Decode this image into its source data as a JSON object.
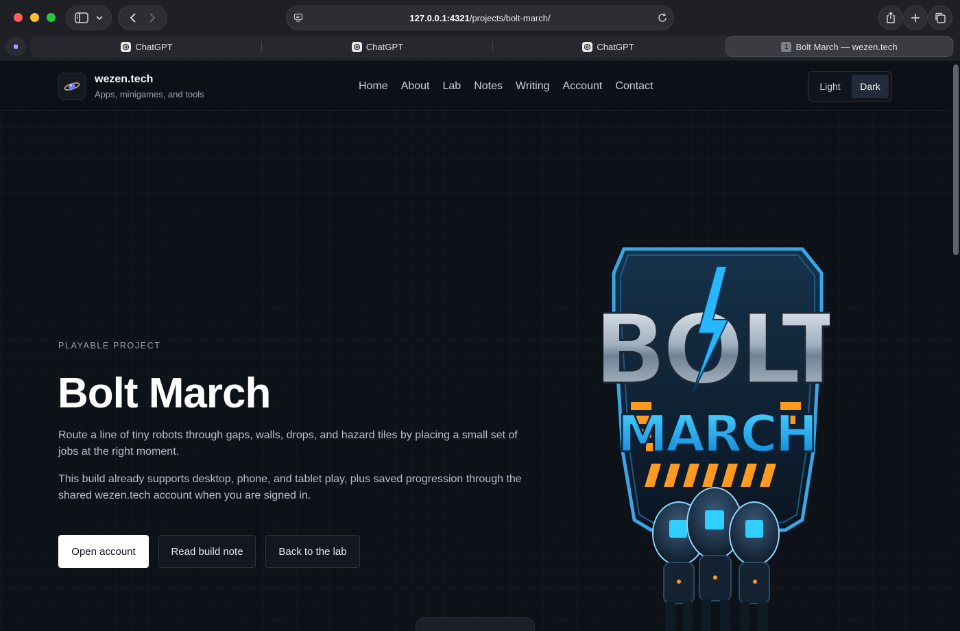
{
  "browser": {
    "url_host": "127.0.0.1:4321",
    "url_path": "/projects/bolt-march/",
    "tabs": [
      {
        "label": "ChatGPT"
      },
      {
        "label": "ChatGPT"
      },
      {
        "label": "ChatGPT"
      },
      {
        "label": "Bolt March — wezen.tech",
        "index": "1",
        "active": true
      }
    ]
  },
  "site": {
    "brand_name": "wezen.tech",
    "brand_tagline": "Apps, minigames, and tools",
    "nav": [
      "Home",
      "About",
      "Lab",
      "Notes",
      "Writing",
      "Account",
      "Contact"
    ],
    "theme": {
      "light": "Light",
      "dark": "Dark",
      "selected": "Dark"
    }
  },
  "hero": {
    "eyebrow": "PLAYABLE PROJECT",
    "title": "Bolt March",
    "p1": "Route a line of tiny robots through gaps, walls, drops, and hazard tiles by placing a small set of jobs at the right moment.",
    "p2": "This build already supports desktop, phone, and tablet play, plus saved progression through the shared wezen.tech account when you are signed in.",
    "buttons": {
      "open_account": "Open account",
      "read_build_note": "Read build note",
      "back_to_lab": "Back to the lab"
    },
    "logo_text": [
      "BOLT",
      "MARCH"
    ]
  },
  "colors": {
    "accent_blue": "#1ea7ff",
    "accent_orange": "#ff9a1f",
    "page_bg": "#0d1118"
  }
}
